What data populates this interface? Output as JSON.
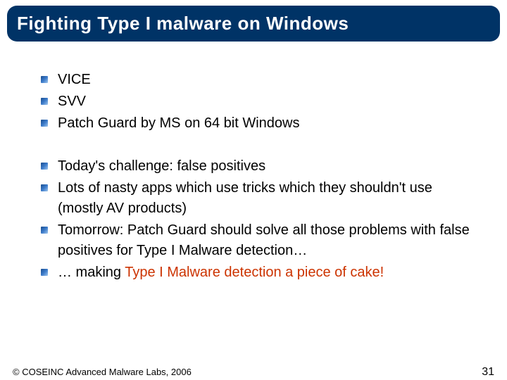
{
  "title": "Fighting Type I malware on Windows",
  "group1": [
    {
      "text": "VICE"
    },
    {
      "text": "SVV"
    },
    {
      "text": "Patch Guard by MS on 64 bit Windows"
    }
  ],
  "group2": [
    {
      "text": "Today's challenge: false positives"
    },
    {
      "text": "Lots of nasty apps which use tricks which they shouldn't use (mostly AV products)"
    },
    {
      "text": "Tomorrow: Patch Guard should solve all those problems with false positives for Type I Malware detection…"
    },
    {
      "prefix": "… making ",
      "highlight": "Type I Malware detection a piece of cake!"
    }
  ],
  "footer": {
    "copyright": "© COSEINC Advanced Malware Labs, 2006",
    "page": "31"
  }
}
